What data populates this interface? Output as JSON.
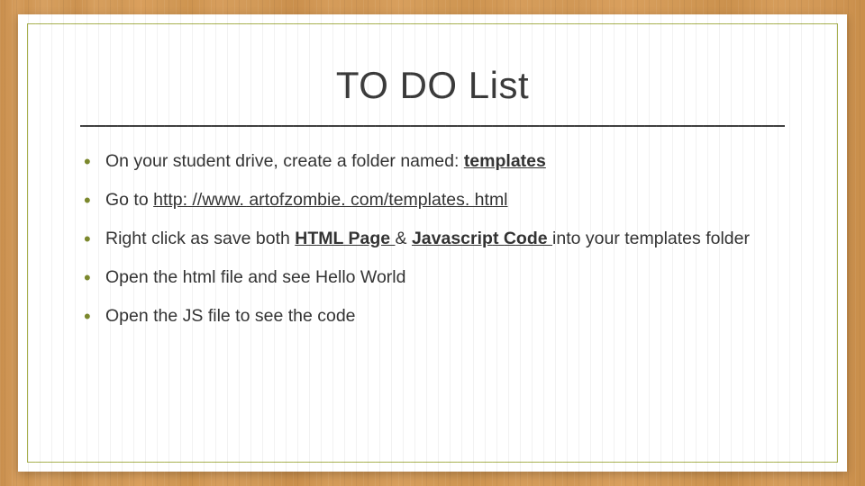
{
  "title": "TO DO List",
  "bullets": {
    "b1": {
      "pre": "On your student drive, create a folder named: ",
      "bold": "templates"
    },
    "b2": {
      "pre": "Go to ",
      "link": "http: //www. artofzombie. com/templates. html"
    },
    "b3": {
      "pre": "Right click as save both ",
      "bold1": "HTML Page ",
      "mid": "& ",
      "bold2": "Javascript Code ",
      "post": "into your templates folder"
    },
    "b4": "Open the html file and see Hello World",
    "b5": "Open the JS file to see the code"
  }
}
